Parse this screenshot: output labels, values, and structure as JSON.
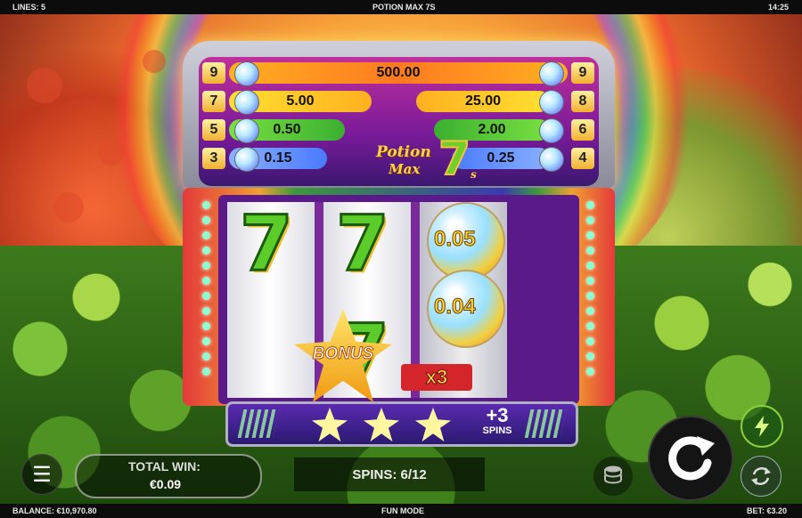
{
  "topbar": {
    "lines": "LINES: 5",
    "title": "POTION MAX 7S",
    "time": "14:25"
  },
  "paytable": {
    "rows": [
      {
        "left_count": "9",
        "value": "500.00",
        "right_count": "9"
      },
      {
        "left_count": "7",
        "left_value": "5.00",
        "right_value": "25.00",
        "right_count": "8"
      },
      {
        "left_count": "5",
        "left_value": "0.50",
        "right_value": "2.00",
        "right_count": "6"
      },
      {
        "left_count": "3",
        "left_value": "0.15",
        "right_value": "0.25",
        "right_count": "4"
      }
    ]
  },
  "logo": {
    "line1": "Potion",
    "line2": "Max",
    "seven": "7",
    "suffix": "s"
  },
  "reels": {
    "potion_values": [
      "0.05",
      "0.04"
    ],
    "bonus_label": "BONUS",
    "multiplier": "x3"
  },
  "tray": {
    "spins_count": "+3",
    "spins_label": "SPINS"
  },
  "hud": {
    "total_win_label": "TOTAL WIN:",
    "total_win_value": "€0.09",
    "spins_text": "SPINS: 6/12"
  },
  "bottombar": {
    "balance": "BALANCE: €10,970.80",
    "mode": "FUN MODE",
    "bet": "BET: €3.20"
  },
  "icons": {
    "menu": "hamburger-menu-icon",
    "stake": "coin-stack-icon",
    "spin": "spin-arrow-icon",
    "turbo": "lightning-icon",
    "autoplay": "autoplay-icon"
  },
  "colors": {
    "reel_green": "#5ccc2a",
    "gold": "#ffd830",
    "purple": "#5a1a8a",
    "turbo_green": "#8ad03a"
  }
}
